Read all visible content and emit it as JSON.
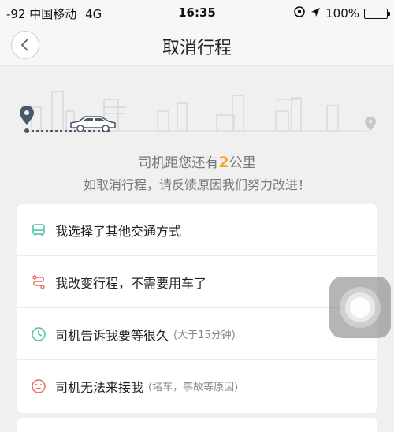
{
  "status_bar": {
    "carrier": "-92 中国移动",
    "network": "4G",
    "time": "16:35",
    "battery": "100%"
  },
  "nav": {
    "title": "取消行程"
  },
  "hero": {
    "distance_prefix": "司机距您还有",
    "distance_value": "2",
    "distance_suffix": "公里",
    "message": "如取消行程，请反馈原因我们努力改进！"
  },
  "reasons": [
    {
      "label": "我选择了其他交通方式",
      "hint": "",
      "icon": "bus-icon",
      "color": "#4cbfa6"
    },
    {
      "label": "我改变行程，不需要用车了",
      "hint": "",
      "icon": "route-icon",
      "color": "#e86a5a"
    },
    {
      "label": "司机告诉我要等很久",
      "hint": "(大于15分钟)",
      "icon": "clock-icon",
      "color": "#4cbfa6"
    },
    {
      "label": "司机无法来接我",
      "hint": "(堵车，事故等原因)",
      "icon": "sad-face-icon",
      "color": "#e86a5a"
    }
  ],
  "colors": {
    "accent": "#f5a623",
    "background": "#f0f0f0"
  }
}
